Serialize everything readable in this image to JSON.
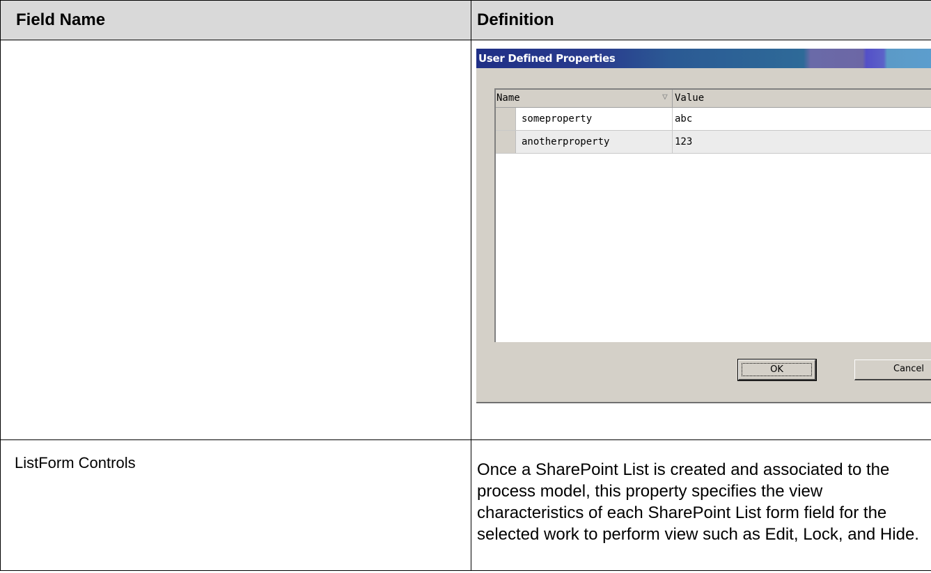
{
  "table": {
    "headers": [
      "Field Name",
      "Definition"
    ],
    "rows": [
      {
        "field_name": "",
        "definition": ""
      },
      {
        "field_name": "ListForm Controls",
        "definition": "Once a SharePoint List is created and associated to the process model, this property specifies the view characteristics of each SharePoint List form field for the selected work to perform view such as Edit, Lock, and Hide."
      }
    ]
  },
  "dialog": {
    "title": "User Defined Properties",
    "columns": [
      "Name",
      "Value"
    ],
    "sort_indicator": "▽",
    "rows": [
      {
        "name": "someproperty",
        "value": "abc"
      },
      {
        "name": "anotherproperty",
        "value": "123"
      }
    ],
    "ok_label": "OK",
    "cancel_label": "Cancel"
  }
}
